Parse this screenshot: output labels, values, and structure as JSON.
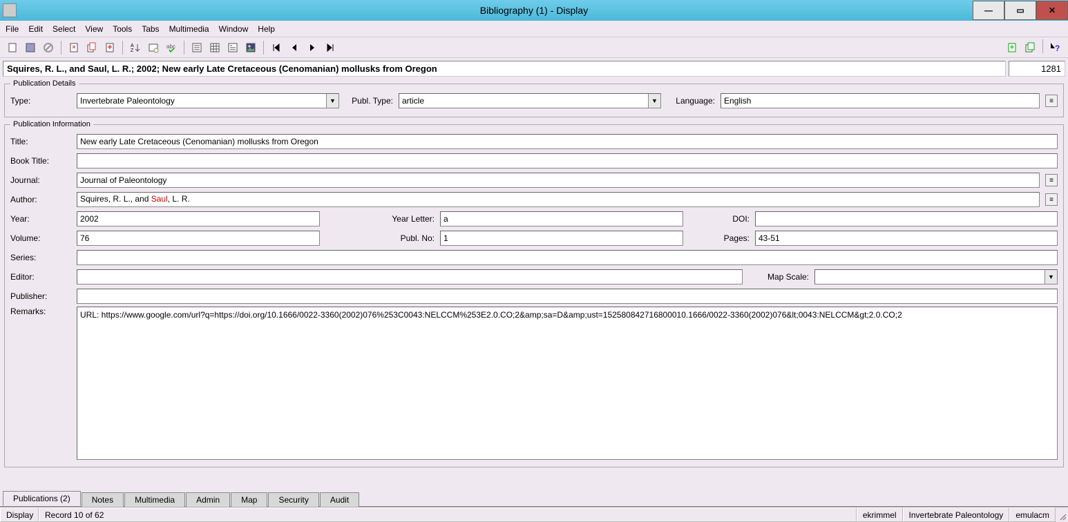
{
  "window": {
    "title": "Bibliography (1) - Display"
  },
  "menu": {
    "file": "File",
    "edit": "Edit",
    "select": "Select",
    "view": "View",
    "tools": "Tools",
    "tabs": "Tabs",
    "multimedia": "Multimedia",
    "window": "Window",
    "help": "Help"
  },
  "header": {
    "citation": "Squires, R. L., and Saul, L. R.; 2002; New early Late Cretaceous (Cenomanian) mollusks from Oregon",
    "record_id": "1281"
  },
  "publication_details": {
    "legend": "Publication Details",
    "type_label": "Type:",
    "type_value": "Invertebrate Paleontology",
    "publ_type_label": "Publ. Type:",
    "publ_type_value": "article",
    "language_label": "Language:",
    "language_value": "English"
  },
  "publication_info": {
    "legend": "Publication Information",
    "title_label": "Title:",
    "title_value": "New early Late Cretaceous (Cenomanian) mollusks from Oregon",
    "book_title_label": "Book Title:",
    "book_title_value": "",
    "journal_label": "Journal:",
    "journal_value": "Journal of Paleontology",
    "author_label": "Author:",
    "author_part1": "Squires, R. L., and ",
    "author_red": "Saul",
    "author_part2": ", L. R.",
    "year_label": "Year:",
    "year_value": "2002",
    "year_letter_label": "Year Letter:",
    "year_letter_value": "a",
    "doi_label": "DOI:",
    "doi_value": "",
    "volume_label": "Volume:",
    "volume_value": "76",
    "publ_no_label": "Publ. No:",
    "publ_no_value": "1",
    "pages_label": "Pages:",
    "pages_value": "43-51",
    "series_label": "Series:",
    "series_value": "",
    "editor_label": "Editor:",
    "editor_value": "",
    "map_scale_label": "Map Scale:",
    "map_scale_value": "",
    "publisher_label": "Publisher:",
    "publisher_value": "",
    "remarks_label": "Remarks:",
    "remarks_value": "URL: https://www.google.com/url?q=https://doi.org/10.1666/0022-3360(2002)076%253C0043:NELCCM%253E2.0.CO;2&amp;sa=D&amp;ust=152580842716800010.1666/0022-3360(2002)076&lt;0043:NELCCM&gt;2.0.CO;2"
  },
  "tabs": {
    "publications": "Publications (2)",
    "notes": "Notes",
    "multimedia": "Multimedia",
    "admin": "Admin",
    "map": "Map",
    "security": "Security",
    "audit": "Audit"
  },
  "status": {
    "mode": "Display",
    "record": "Record 10 of 62",
    "user": "ekrimmel",
    "dept": "Invertebrate Paleontology",
    "server": "emulacm"
  }
}
